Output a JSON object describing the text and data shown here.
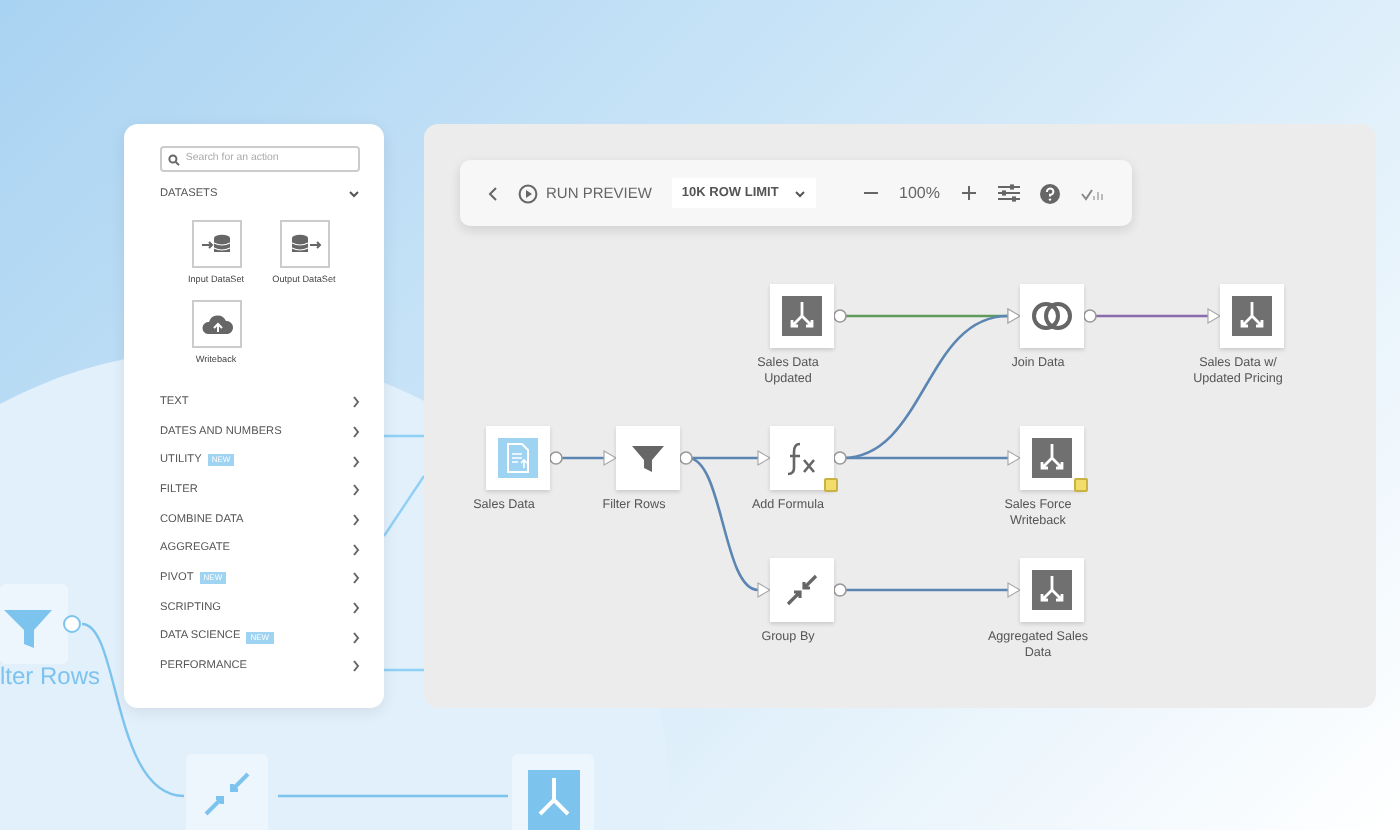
{
  "background": {
    "faded_node_label": "lter Rows"
  },
  "actions_panel": {
    "search": {
      "placeholder": "Search for an action"
    },
    "datasets": {
      "label": "DATASETS",
      "expanded": true,
      "items": [
        {
          "label": "Input DataSet",
          "kind": "input"
        },
        {
          "label": "Output DataSet",
          "kind": "output"
        },
        {
          "label": "Writeback",
          "kind": "writeback"
        }
      ]
    },
    "categories": [
      {
        "label": "TEXT"
      },
      {
        "label": "DATES AND NUMBERS"
      },
      {
        "label": "UTILITY",
        "badge": "NEW"
      },
      {
        "label": "FILTER"
      },
      {
        "label": "COMBINE DATA"
      },
      {
        "label": "AGGREGATE"
      },
      {
        "label": "PIVOT",
        "badge": "NEW"
      },
      {
        "label": "SCRIPTING"
      },
      {
        "label": "DATA SCIENCE",
        "badge": "NEW"
      },
      {
        "label": "PERFORMANCE"
      }
    ]
  },
  "toolbar": {
    "run_preview": "RUN PREVIEW",
    "row_limit": "10K ROW LIMIT",
    "zoom": "100%"
  },
  "nodes": [
    {
      "label": "Sales Data",
      "kind": "dataset",
      "note": false
    },
    {
      "label": "Filter Rows",
      "kind": "filter",
      "note": false
    },
    {
      "label": "Sales Data Updated",
      "kind": "output",
      "note": false
    },
    {
      "label": "Add Formula",
      "kind": "formula",
      "note": true
    },
    {
      "label": "Group By",
      "kind": "groupby",
      "note": false
    },
    {
      "label": "Join Data",
      "kind": "join",
      "note": false
    },
    {
      "label": "Sales Force Writeback",
      "kind": "output",
      "note": true
    },
    {
      "label": "Aggregated Sales Data",
      "kind": "output",
      "note": false
    },
    {
      "label": "Sales Data w/ Updated Pricing",
      "kind": "output",
      "note": false
    }
  ],
  "edges": [
    {
      "color": "#5b86b3"
    },
    {
      "color": "#5b86b3"
    },
    {
      "color": "#5b86b3"
    },
    {
      "color": "#5f9a5a"
    },
    {
      "color": "#5b86b3"
    },
    {
      "color": "#5b86b3"
    },
    {
      "color": "#5b86b3"
    },
    {
      "color": "#8b6bb0"
    }
  ]
}
